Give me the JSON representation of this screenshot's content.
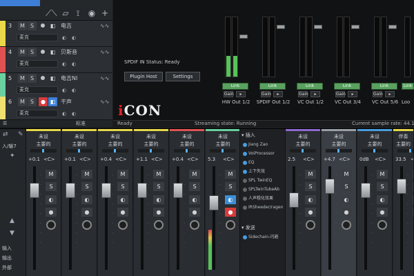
{
  "tracks": {
    "items": [
      {
        "num": "3",
        "color": "#e8d84a",
        "name": "电吉",
        "input": "麦克"
      },
      {
        "num": "4",
        "color": "#e05252",
        "name": "贝斯音",
        "input": "麦克"
      },
      {
        "num": "5",
        "color": "#6ad0a0",
        "name": "电吉NI",
        "input": "麦克"
      },
      {
        "num": "6",
        "color": "#f0e070",
        "name": "干声",
        "input": "麦克"
      }
    ],
    "footer": "Ready",
    "footer_right": "标准"
  },
  "device": {
    "spdif_status": "SPDIF IN Status: Ready",
    "plugin_host": "Plugin Host",
    "settings": "Settings",
    "logo_i": "i",
    "logo_rest": "CON",
    "outputs": [
      {
        "label": "HW Out 1/2",
        "link": "Link"
      },
      {
        "label": "SPDIF Out 1/2",
        "link": "Link"
      },
      {
        "label": "VC Out 1/2",
        "link": "Link"
      },
      {
        "label": "VC Out 3/4",
        "link": "Link"
      },
      {
        "label": "VC Out 5/6",
        "link": "Link"
      },
      {
        "label": "Loo",
        "link": "Link"
      }
    ],
    "gain_label": "Gain",
    "footer_left": "Ready",
    "footer_mid": "Streaming state: Running",
    "footer_right": "Current sample rate: 44.100"
  },
  "mixer": {
    "left": {
      "input": "输入",
      "output": "输出",
      "external": "外部",
      "header": "入/输7"
    },
    "channels": [
      {
        "color": "#e8d84a",
        "in": "未设",
        "out": "主要的",
        "vol": "+0.1",
        "pan": "<C>"
      },
      {
        "color": "#e8d84a",
        "in": "未设",
        "out": "主要的",
        "vol": "+0.1",
        "pan": "<C>"
      },
      {
        "color": "#e8d84a",
        "in": "未设",
        "out": "主要的",
        "vol": "+0.4",
        "pan": "<C>"
      },
      {
        "color": "#e8d84a",
        "in": "未设",
        "out": "主要的",
        "vol": "+1.1",
        "pan": "<C>"
      },
      {
        "color": "#e05252",
        "in": "未设",
        "out": "主要的",
        "vol": "+0.4",
        "pan": "<C>"
      },
      {
        "color": "#6ad0a0",
        "in": "未设",
        "out": "主要的",
        "vol": "5.3",
        "pan": "<C>"
      },
      {
        "color": "#8e6ad0",
        "in": "未设",
        "out": "主要的",
        "vol": "2.5",
        "pan": "<C>"
      },
      {
        "color": "#9aa0a6",
        "in": "未设",
        "out": "主要的",
        "vol": "+4.7",
        "pan": "<C>"
      },
      {
        "color": "#4a9de0",
        "in": "未设",
        "out": "主要的",
        "vol": "0dB",
        "pan": "<C>"
      },
      {
        "color": "#e8d84a",
        "in": "伴奏",
        "out": "主要的",
        "vol": "33.5",
        "pan": "<C>"
      }
    ],
    "insert": {
      "header": "插入",
      "items": [
        "Jiang Zao",
        "VoiProcessor",
        "EQ",
        "上下失效",
        "SPL TwinEQ",
        "SPLTwinTubeAb",
        "人声粗化效果",
        "IRSheeder/ragen"
      ],
      "send_header": "发送",
      "send_item": "Sidechain-闪避"
    }
  }
}
